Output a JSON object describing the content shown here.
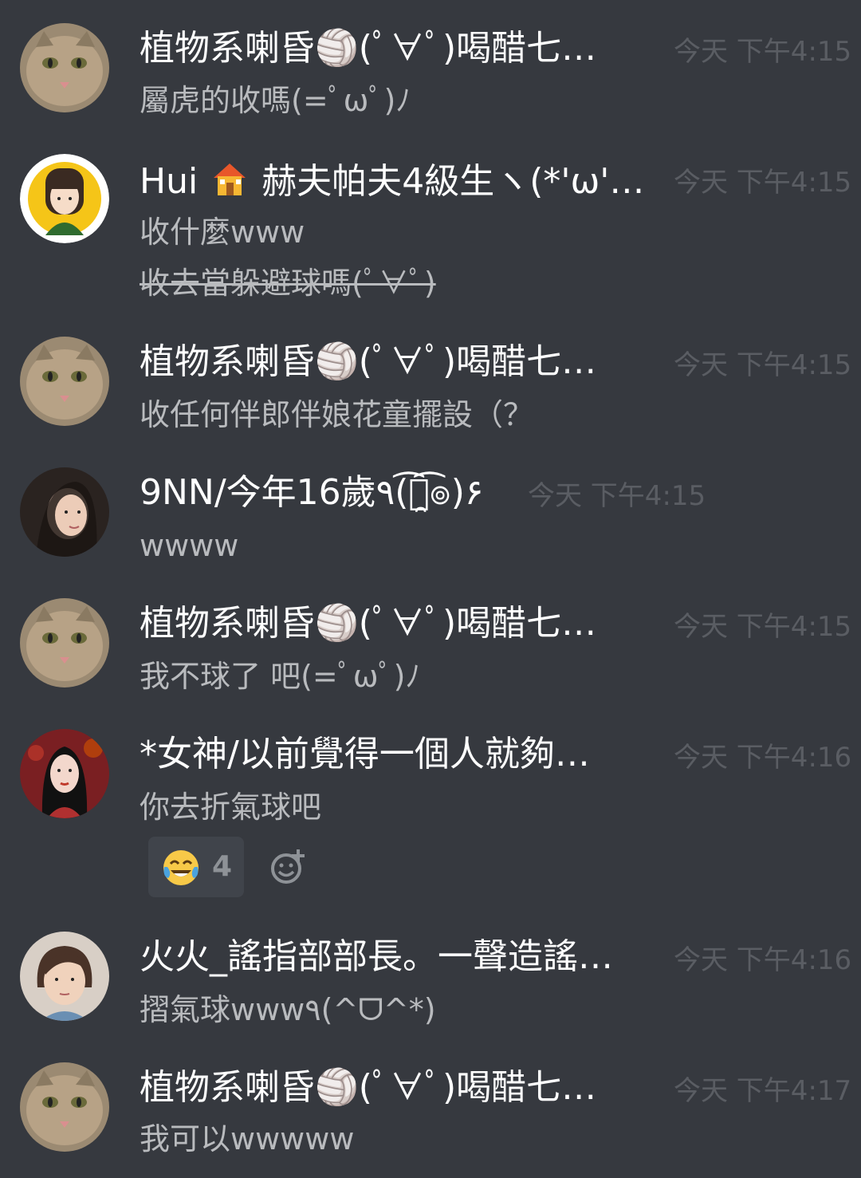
{
  "colors": {
    "background": "#36393f",
    "username": "#ffffff",
    "message_text": "#b9bbbe",
    "timestamp": "#5a5d63",
    "reaction_bg": "#40444b"
  },
  "messages": [
    {
      "avatar": "cat-avatar",
      "username": "植物系喇昏🏐(ﾟ∀ﾟ)喝醋七…",
      "timestamp": "今天 下午4:15",
      "lines": [
        "屬虎的收嗎(=ﾟωﾟ)ﾉ"
      ]
    },
    {
      "avatar": "cartoon-girl-avatar",
      "username_prefix": "Hui",
      "username_icon": "house-icon",
      "username_suffix": "赫夫帕夫4級生ヽ(*'ω'* …",
      "timestamp": "今天 下午4:15",
      "lines": [
        "收什麼www"
      ],
      "strikethrough_line": "收去當躲避球嗎(ﾟ∀ﾟ)"
    },
    {
      "avatar": "cat-avatar",
      "username": "植物系喇昏🏐(ﾟ∀ﾟ)喝醋七…",
      "timestamp": "今天 下午4:15",
      "lines": [
        "收任何伴郎伴娘花童擺設（？"
      ]
    },
    {
      "avatar": "woman-photo-avatar",
      "username": "9NN/今年16歲٩(͡๏̯͡๏)۶",
      "timestamp": "今天 下午4:15",
      "lines": [
        "wwww"
      ]
    },
    {
      "avatar": "cat-avatar",
      "username": "植物系喇昏🏐(ﾟ∀ﾟ)喝醋七…",
      "timestamp": "今天 下午4:15",
      "lines": [
        "我不球了 吧(=ﾟωﾟ)ﾉ"
      ]
    },
    {
      "avatar": "goddess-photo-avatar",
      "username": "*女神/以前覺得一個人就夠…",
      "timestamp": "今天 下午4:16",
      "lines": [
        "你去折氣球吧"
      ],
      "reaction": {
        "emoji": "tears-of-joy-icon",
        "count": "4"
      }
    },
    {
      "avatar": "fire-photo-avatar",
      "username": "火火_謠指部部長。一聲造謠…",
      "timestamp": "今天 下午4:16",
      "lines": [
        "摺氣球www٩(^ᗜ^*)"
      ]
    },
    {
      "avatar": "cat-avatar",
      "username": "植物系喇昏🏐(ﾟ∀ﾟ)喝醋七…",
      "timestamp": "今天 下午4:17",
      "lines": [
        "我可以wwwww"
      ]
    }
  ]
}
